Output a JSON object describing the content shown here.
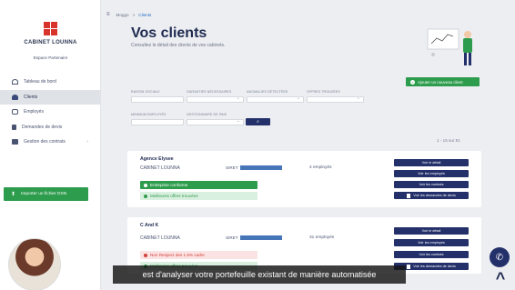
{
  "brand": {
    "name": "CABINET LOUNNA",
    "space": "Espace Partenaire"
  },
  "sidebar": {
    "items": [
      {
        "label": "Tableau de bord",
        "icon": "dashboard-icon"
      },
      {
        "label": "Clients",
        "icon": "user-icon",
        "active": true
      },
      {
        "label": "Employés",
        "icon": "team-icon"
      },
      {
        "label": "Demandes de devis",
        "icon": "document-icon"
      },
      {
        "label": "Gestion des contrats",
        "icon": "folder-icon"
      }
    ],
    "import_label": "Importer un fichier DSN"
  },
  "breadcrumb": {
    "home": "Moggo",
    "separator": ">",
    "current": "Clients"
  },
  "header": {
    "title": "Vos clients",
    "subtitle": "Consultez le détail des clients de vos cabinets.",
    "add_label": "Ajouter un nouveau client"
  },
  "filters": {
    "raison_sociale": "RAISON SOCIALE",
    "garanties": "GARANTIES NÉCESSAIRES",
    "anomalies": "ANOMALIES DÉTECTÉES",
    "offres": "OFFRES TROUVÉES",
    "minimum": "MINIMUM EMPLOYÉS",
    "gestionnaire": "GESTIONNAIRE DE PAIE",
    "search_icon": "search-icon"
  },
  "pagination": "1 - 15 sur 81",
  "clients": [
    {
      "name": "Agence Elysee",
      "cabinet": "CABINET LOUNNA",
      "siret_label": "SIRET",
      "employees": "4 employés",
      "tags": [
        "Entreprise conforme",
        "Meilleures offres trouvées"
      ]
    },
    {
      "name": "C And K",
      "cabinet": "CABINET LOUNNA",
      "siret_label": "SIRET",
      "employees": "31 employés",
      "tags": [
        "Non Respect des 1.5% cadre",
        "Meilleures offres trouvées"
      ]
    }
  ],
  "actions": {
    "detail": "Voir le détail",
    "employees": "Voir les employés",
    "contracts": "Voir les contrats",
    "quotes": "Voir les demandes de devis"
  },
  "subtitle_text": "est d'analyser votre portefeuille existant de manière automatisée",
  "colors": {
    "primary": "#23306a",
    "green": "#2e9c4d",
    "red": "#d0423a",
    "logo": "#d9342b"
  }
}
